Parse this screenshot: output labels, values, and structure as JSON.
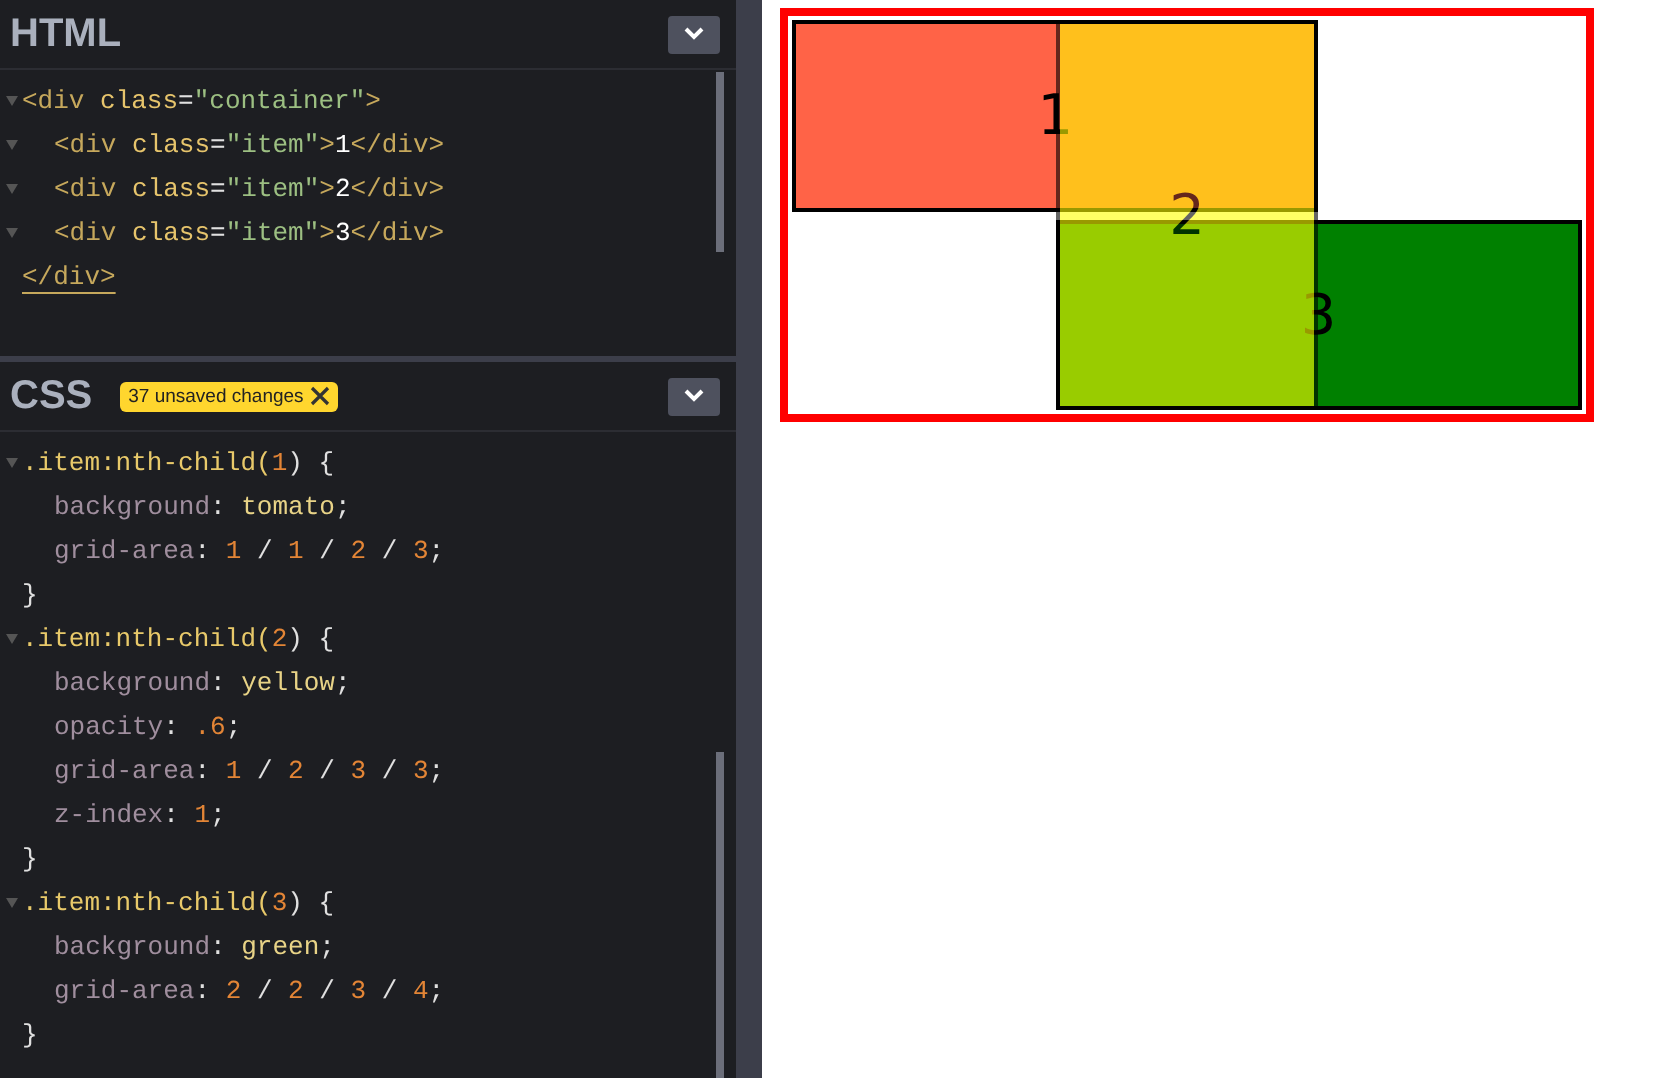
{
  "panels": [
    {
      "title": "HTML",
      "lines": [
        {
          "foldable": true,
          "indented": false,
          "tokens": [
            {
              "t": "<div ",
              "kind": "tag"
            },
            {
              "t": "class",
              "kind": "attr"
            },
            {
              "t": "=",
              "kind": "punct"
            },
            {
              "t": "\"container\"",
              "kind": "str"
            },
            {
              "t": ">",
              "kind": "tag"
            }
          ]
        },
        {
          "foldable": true,
          "indented": true,
          "tokens": [
            {
              "t": "<div ",
              "kind": "tag"
            },
            {
              "t": "class",
              "kind": "attr"
            },
            {
              "t": "=",
              "kind": "punct"
            },
            {
              "t": "\"item\"",
              "kind": "str"
            },
            {
              "t": ">",
              "kind": "tag"
            },
            {
              "t": "1",
              "kind": "text"
            },
            {
              "t": "</div>",
              "kind": "tag"
            }
          ]
        },
        {
          "foldable": true,
          "indented": true,
          "tokens": [
            {
              "t": "<div ",
              "kind": "tag"
            },
            {
              "t": "class",
              "kind": "attr"
            },
            {
              "t": "=",
              "kind": "punct"
            },
            {
              "t": "\"item\"",
              "kind": "str"
            },
            {
              "t": ">",
              "kind": "tag"
            },
            {
              "t": "2",
              "kind": "text"
            },
            {
              "t": "</div>",
              "kind": "tag"
            }
          ]
        },
        {
          "foldable": true,
          "indented": true,
          "tokens": [
            {
              "t": "<div ",
              "kind": "tag"
            },
            {
              "t": "class",
              "kind": "attr"
            },
            {
              "t": "=",
              "kind": "punct"
            },
            {
              "t": "\"item\"",
              "kind": "str"
            },
            {
              "t": ">",
              "kind": "tag"
            },
            {
              "t": "3",
              "kind": "text"
            },
            {
              "t": "</div>",
              "kind": "tag"
            }
          ]
        },
        {
          "foldable": false,
          "indented": false,
          "tokens": [
            {
              "t": "</div>",
              "kind": "matched"
            }
          ]
        }
      ]
    },
    {
      "title": "CSS",
      "badge": "37 unsaved changes",
      "lines": [
        {
          "foldable": true,
          "indented": false,
          "tokens": [
            {
              "t": ".item:nth-child(",
              "kind": "sel"
            },
            {
              "t": "1",
              "kind": "num"
            },
            {
              "t": ") {",
              "kind": "punct"
            }
          ]
        },
        {
          "foldable": false,
          "indented": true,
          "tokens": [
            {
              "t": "background",
              "kind": "prop"
            },
            {
              "t": ": ",
              "kind": "punct"
            },
            {
              "t": "tomato",
              "kind": "value"
            },
            {
              "t": ";",
              "kind": "punct"
            }
          ]
        },
        {
          "foldable": false,
          "indented": true,
          "tokens": [
            {
              "t": "grid-area",
              "kind": "prop"
            },
            {
              "t": ": ",
              "kind": "punct"
            },
            {
              "t": "1",
              "kind": "num"
            },
            {
              "t": " / ",
              "kind": "punct"
            },
            {
              "t": "1",
              "kind": "num"
            },
            {
              "t": " / ",
              "kind": "punct"
            },
            {
              "t": "2",
              "kind": "num"
            },
            {
              "t": " / ",
              "kind": "punct"
            },
            {
              "t": "3",
              "kind": "num"
            },
            {
              "t": ";",
              "kind": "punct"
            }
          ]
        },
        {
          "foldable": false,
          "indented": false,
          "tokens": [
            {
              "t": "}",
              "kind": "punct"
            }
          ]
        },
        {
          "foldable": true,
          "indented": false,
          "tokens": [
            {
              "t": ".item:nth-child(",
              "kind": "sel"
            },
            {
              "t": "2",
              "kind": "num"
            },
            {
              "t": ") {",
              "kind": "punct"
            }
          ]
        },
        {
          "foldable": false,
          "indented": true,
          "tokens": [
            {
              "t": "background",
              "kind": "prop"
            },
            {
              "t": ": ",
              "kind": "punct"
            },
            {
              "t": "yellow",
              "kind": "value"
            },
            {
              "t": ";",
              "kind": "punct"
            }
          ]
        },
        {
          "foldable": false,
          "indented": true,
          "tokens": [
            {
              "t": "opacity",
              "kind": "prop"
            },
            {
              "t": ": ",
              "kind": "punct"
            },
            {
              "t": ".6",
              "kind": "num"
            },
            {
              "t": ";",
              "kind": "punct"
            }
          ]
        },
        {
          "foldable": false,
          "indented": true,
          "tokens": [
            {
              "t": "grid-area",
              "kind": "prop"
            },
            {
              "t": ": ",
              "kind": "punct"
            },
            {
              "t": "1",
              "kind": "num"
            },
            {
              "t": " / ",
              "kind": "punct"
            },
            {
              "t": "2",
              "kind": "num"
            },
            {
              "t": " / ",
              "kind": "punct"
            },
            {
              "t": "3",
              "kind": "num"
            },
            {
              "t": " / ",
              "kind": "punct"
            },
            {
              "t": "3",
              "kind": "num"
            },
            {
              "t": ";",
              "kind": "punct"
            }
          ]
        },
        {
          "foldable": false,
          "indented": true,
          "tokens": [
            {
              "t": "z-index",
              "kind": "prop"
            },
            {
              "t": ": ",
              "kind": "punct"
            },
            {
              "t": "1",
              "kind": "num"
            },
            {
              "t": ";",
              "kind": "punct"
            }
          ]
        },
        {
          "foldable": false,
          "indented": false,
          "tokens": [
            {
              "t": "}",
              "kind": "punct"
            }
          ]
        },
        {
          "foldable": true,
          "indented": false,
          "tokens": [
            {
              "t": ".item:nth-child(",
              "kind": "sel"
            },
            {
              "t": "3",
              "kind": "num"
            },
            {
              "t": ") {",
              "kind": "punct"
            }
          ]
        },
        {
          "foldable": false,
          "indented": true,
          "tokens": [
            {
              "t": "background",
              "kind": "prop"
            },
            {
              "t": ": ",
              "kind": "punct"
            },
            {
              "t": "green",
              "kind": "value"
            },
            {
              "t": ";",
              "kind": "punct"
            }
          ]
        },
        {
          "foldable": false,
          "indented": true,
          "tokens": [
            {
              "t": "grid-area",
              "kind": "prop"
            },
            {
              "t": ": ",
              "kind": "punct"
            },
            {
              "t": "2",
              "kind": "num"
            },
            {
              "t": " / ",
              "kind": "punct"
            },
            {
              "t": "2",
              "kind": "num"
            },
            {
              "t": " / ",
              "kind": "punct"
            },
            {
              "t": "3",
              "kind": "num"
            },
            {
              "t": " / ",
              "kind": "punct"
            },
            {
              "t": "4",
              "kind": "num"
            },
            {
              "t": ";",
              "kind": "punct"
            }
          ]
        },
        {
          "foldable": false,
          "indented": false,
          "tokens": [
            {
              "t": "}",
              "kind": "punct"
            }
          ]
        }
      ]
    }
  ],
  "preview": {
    "items": [
      {
        "label": "1"
      },
      {
        "label": "2"
      },
      {
        "label": "3"
      }
    ]
  }
}
